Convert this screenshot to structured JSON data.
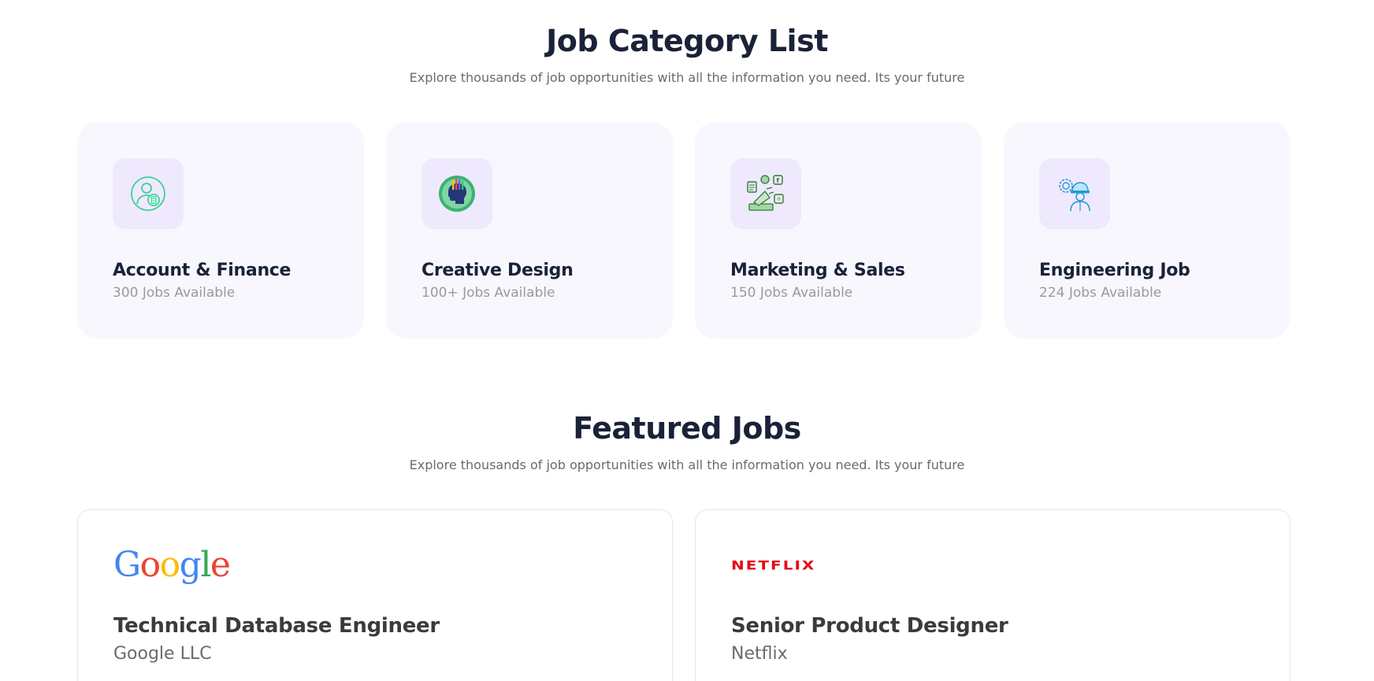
{
  "categories_section": {
    "title": "Job Category List",
    "subtitle": "Explore thousands of job opportunities with all the information you need. Its your future"
  },
  "categories": [
    {
      "name": "Account & Finance",
      "count": "300 Jobs Available",
      "icon": "account-finance-icon"
    },
    {
      "name": "Creative Design",
      "count": "100+ Jobs Available",
      "icon": "creative-design-icon"
    },
    {
      "name": "Marketing & Sales",
      "count": "150 Jobs Available",
      "icon": "marketing-sales-icon"
    },
    {
      "name": "Engineering Job",
      "count": "224 Jobs Available",
      "icon": "engineering-icon"
    }
  ],
  "featured_section": {
    "title": "Featured Jobs",
    "subtitle": "Explore thousands of job opportunities with all the information you need. Its your future"
  },
  "jobs": [
    {
      "logo": "Google",
      "title": "Technical Database Engineer",
      "company": "Google LLC"
    },
    {
      "logo": "NETFLIX",
      "title": "Senior Product Designer",
      "company": "Netflix"
    }
  ],
  "colors": {
    "heading": "#1a2238",
    "card_bg": "#f8f7fe",
    "icon_bg": "#efe9fd",
    "tag_border": "#7b6cf6",
    "netflix_red": "#e50914"
  }
}
